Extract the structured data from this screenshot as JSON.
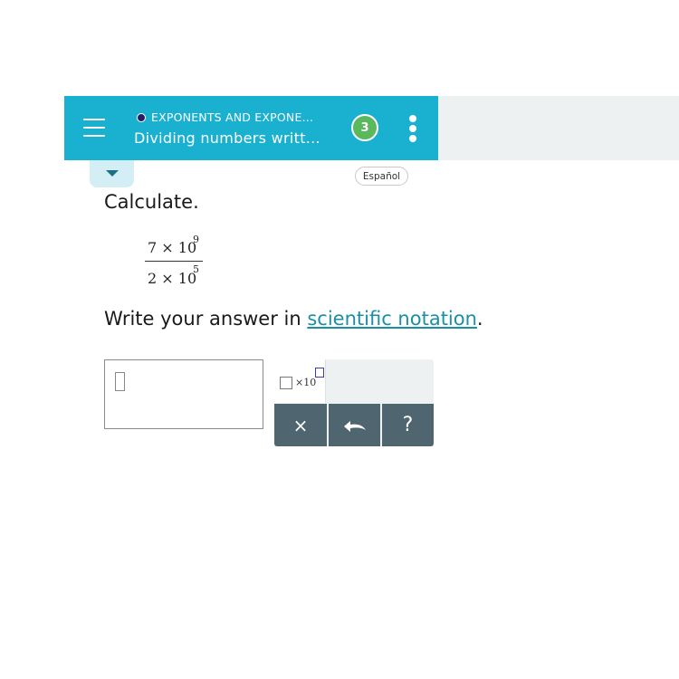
{
  "header": {
    "menu_icon": "hamburger-menu-icon",
    "topic": "EXPONENTS AND EXPONE...",
    "title": "Dividing numbers writt...",
    "progress_count": "3",
    "more_icon": "vertical-ellipsis-icon",
    "accent_color": "#1ab0cf",
    "progress_color": "#5cb85c"
  },
  "collapse_icon": "triangle-down-icon",
  "language_button": "Español",
  "question": {
    "prompt": "Calculate.",
    "expression": {
      "numerator": {
        "base": "7 × 10",
        "exponent": "9"
      },
      "denominator": {
        "base": "2 × 10",
        "exponent": "5"
      }
    },
    "instruction_before": "Write your answer in ",
    "instruction_link": "scientific notation",
    "instruction_after": "."
  },
  "answer": {
    "value": ""
  },
  "keypad": {
    "sci_key_text": "×10",
    "clear_label": "×",
    "undo_icon": "undo-icon",
    "help_label": "?",
    "key_color": "#4f6670"
  }
}
